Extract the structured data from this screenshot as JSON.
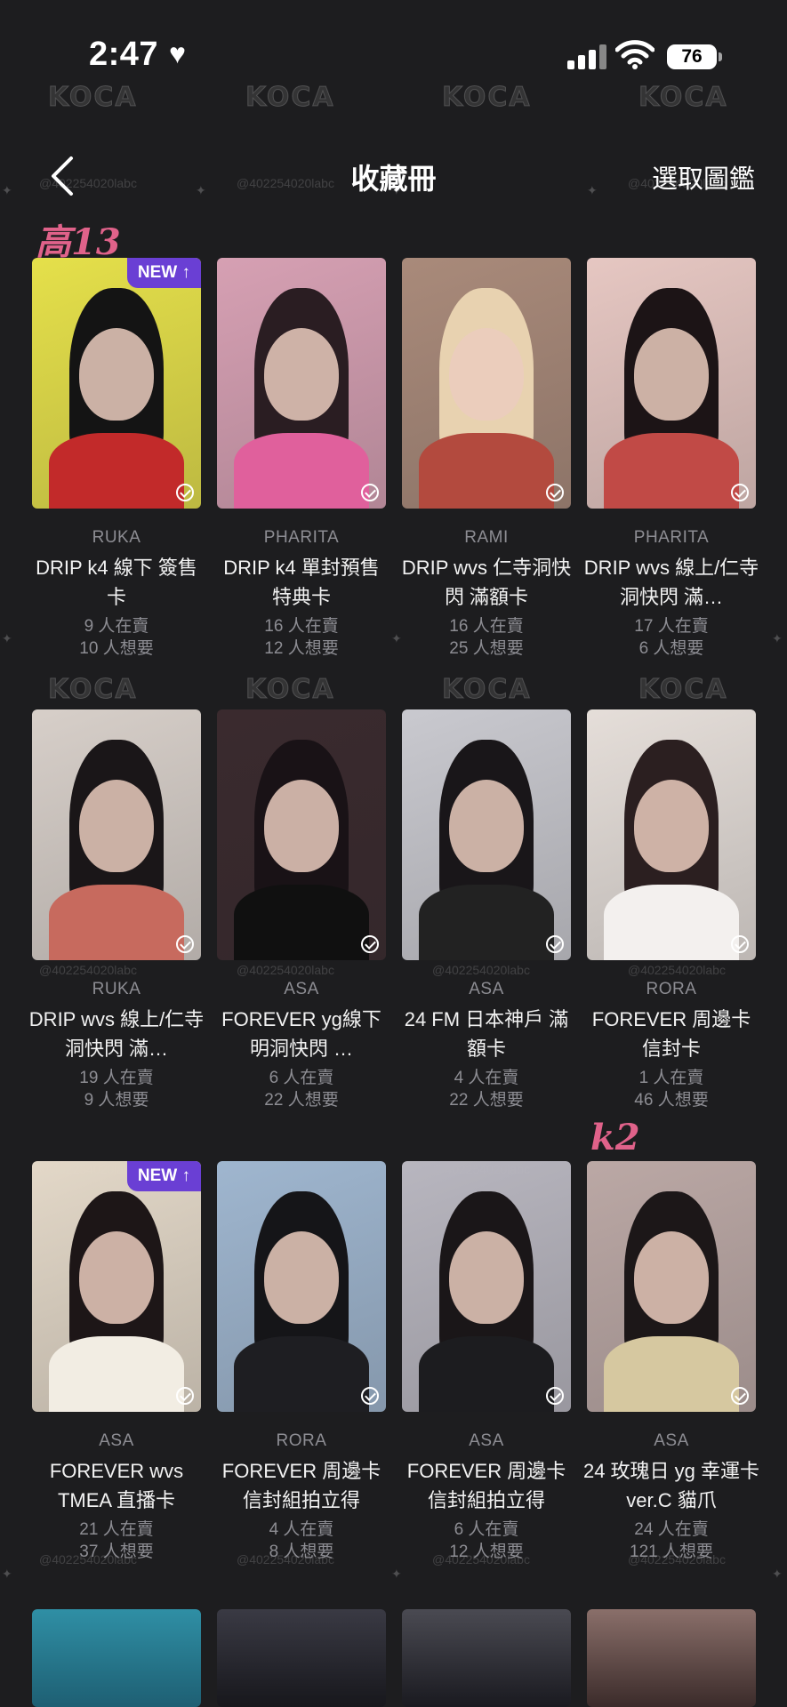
{
  "status_bar": {
    "time": "2:47",
    "battery": "76"
  },
  "nav": {
    "title": "收藏冊",
    "select_label": "選取圖鑑",
    "back_icon": "chevron-left-icon"
  },
  "watermark": {
    "logo": "KOCA",
    "handle": "@402254020labc"
  },
  "badge_label": "NEW ↑",
  "cards": [
    {
      "member": "RUKA",
      "title": "DRIP k4 線下 簽售卡",
      "selling": "9 人在賣",
      "wanting": "10 人想要",
      "new": true,
      "doodle": "高13"
    },
    {
      "member": "PHARITA",
      "title": "DRIP k4 單封預售 特典卡",
      "selling": "16 人在賣",
      "wanting": "12 人想要",
      "new": false
    },
    {
      "member": "RAMI",
      "title": "DRIP wvs 仁寺洞快閃 滿額卡",
      "selling": "16 人在賣",
      "wanting": "25 人想要",
      "new": false
    },
    {
      "member": "PHARITA",
      "title": "DRIP wvs 線上/仁寺洞快閃 滿…",
      "selling": "17 人在賣",
      "wanting": "6 人想要",
      "new": false
    },
    {
      "member": "RUKA",
      "title": "DRIP wvs 線上/仁寺洞快閃 滿…",
      "selling": "19 人在賣",
      "wanting": "9 人想要",
      "new": false
    },
    {
      "member": "ASA",
      "title": "FOREVER yg線下 明洞快閃 …",
      "selling": "6 人在賣",
      "wanting": "22 人想要",
      "new": false
    },
    {
      "member": "ASA",
      "title": "24 FM 日本神戶 滿額卡",
      "selling": "4 人在賣",
      "wanting": "22 人想要",
      "new": false
    },
    {
      "member": "RORA",
      "title": "FOREVER 周邊卡 信封卡",
      "selling": "1 人在賣",
      "wanting": "46 人想要",
      "new": false
    },
    {
      "member": "ASA",
      "title": "FOREVER wvs TMEA 直播卡",
      "selling": "21 人在賣",
      "wanting": "37 人想要",
      "new": true
    },
    {
      "member": "RORA",
      "title": "FOREVER 周邊卡 信封組拍立得",
      "selling": "4 人在賣",
      "wanting": "8 人想要",
      "new": false
    },
    {
      "member": "ASA",
      "title": "FOREVER 周邊卡 信封組拍立得",
      "selling": "6 人在賣",
      "wanting": "12 人想要",
      "new": false
    },
    {
      "member": "ASA",
      "title": "24 玫瑰日 yg 幸運卡 ver.C 貓爪",
      "selling": "24 人在賣",
      "wanting": "121 人想要",
      "new": false,
      "doodle": "k2"
    }
  ]
}
